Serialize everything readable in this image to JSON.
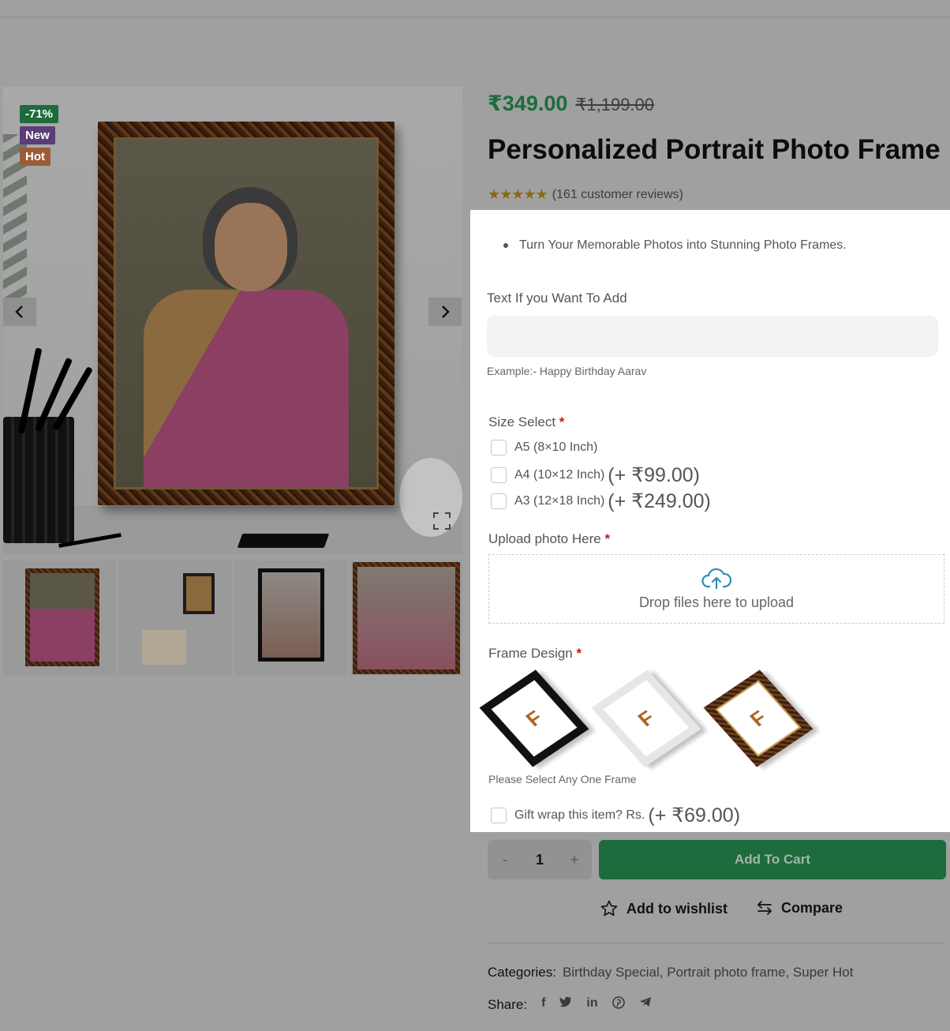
{
  "badges": {
    "sale": "-71%",
    "new": "New",
    "hot": "Hot"
  },
  "product": {
    "price_now": "₹349.00",
    "price_old": "₹1,199.00",
    "title": "Personalized Portrait Photo Frame",
    "rating_stars": "★★★★★",
    "reviews": "(161 customer reviews)",
    "bullet": "Turn Your Memorable Photos into Stunning Photo Frames."
  },
  "text_field": {
    "label": "Text If you Want To Add",
    "value": "",
    "hint": "Example:- Happy Birthday Aarav"
  },
  "size": {
    "label": "Size Select",
    "required_mark": "*",
    "options": [
      {
        "label": "A5 (8×10 Inch)",
        "price": ""
      },
      {
        "label": "A4 (10×12 Inch)",
        "price": "(+ ₹99.00)"
      },
      {
        "label": "A3 (12×18 Inch)",
        "price": "(+ ₹249.00)"
      }
    ]
  },
  "upload": {
    "label": "Upload photo Here",
    "required_mark": "*",
    "drop_text": "Drop files here to upload"
  },
  "frame_design": {
    "label": "Frame Design",
    "required_mark": "*",
    "frames": [
      "black-frame",
      "white-frame",
      "brown-frame"
    ],
    "frame_logo": "F",
    "hint": "Please Select Any One Frame"
  },
  "gift_wrap": {
    "label": "Gift wrap this item? Rs.",
    "price": "(+ ₹69.00)"
  },
  "cart": {
    "minus": "-",
    "qty": "1",
    "plus": "+",
    "add_label": "Add To Cart"
  },
  "actions": {
    "wishlist": "Add to wishlist",
    "compare": "Compare"
  },
  "meta": {
    "categories_label": "Categories:",
    "categories": "Birthday Special, Portrait photo frame, Super Hot",
    "share_label": "Share:",
    "share": {
      "facebook": "f",
      "linkedin": "in"
    }
  },
  "colors": {
    "price": "#1c6c3d",
    "button": "#1e6b3d",
    "required": "#c51a1a"
  }
}
